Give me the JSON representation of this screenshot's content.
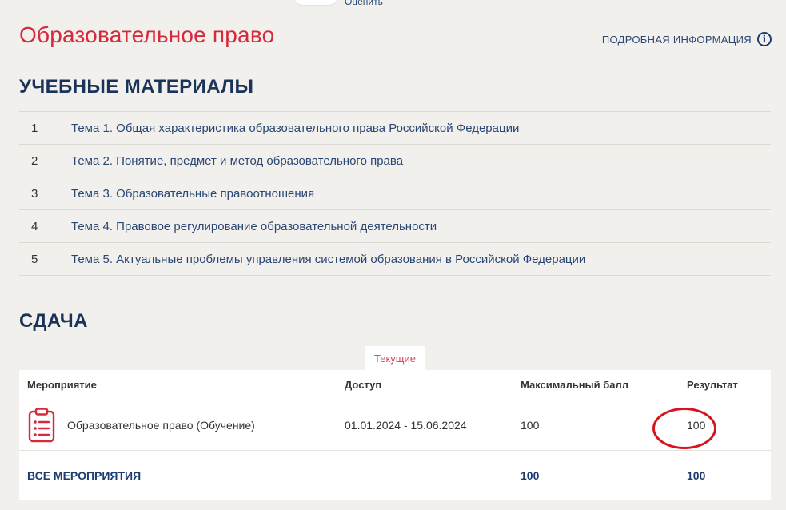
{
  "header": {
    "rate_label": "Оценить",
    "course_title": "Образовательное право",
    "info_label": "ПОДРОБНАЯ ИНФОРМАЦИЯ"
  },
  "materials": {
    "heading": "УЧЕБНЫЕ МАТЕРИАЛЫ",
    "items": [
      {
        "num": "1",
        "title": "Тема 1. Общая характеристика образовательного права Российской Федерации"
      },
      {
        "num": "2",
        "title": "Тема 2. Понятие, предмет и метод образовательного права"
      },
      {
        "num": "3",
        "title": "Тема 3. Образовательные правоотношения"
      },
      {
        "num": "4",
        "title": "Тема 4. Правовое регулирование образовательной деятельности"
      },
      {
        "num": "5",
        "title": "Тема 5. Актуальные проблемы управления системой образования в Российской Федерации"
      }
    ]
  },
  "submission": {
    "heading": "СДАЧА",
    "tab_current": "Текущие",
    "columns": [
      "Мероприятие",
      "Доступ",
      "Максимальный балл",
      "Результат"
    ],
    "rows": [
      {
        "event": "Образовательное право (Обучение)",
        "access": "01.01.2024 - 15.06.2024",
        "max_score": "100",
        "result": "100"
      }
    ],
    "total": {
      "label": "ВСЕ МЕРОПРИЯТИЯ",
      "max_score": "100",
      "result": "100"
    }
  },
  "colors": {
    "title_red": "#d42a3c",
    "heading_navy": "#1a3459",
    "annotation_red": "#d7151f",
    "page_bg": "#f2f0ed"
  },
  "icons": [
    "info-icon",
    "clipboard-list-icon"
  ]
}
